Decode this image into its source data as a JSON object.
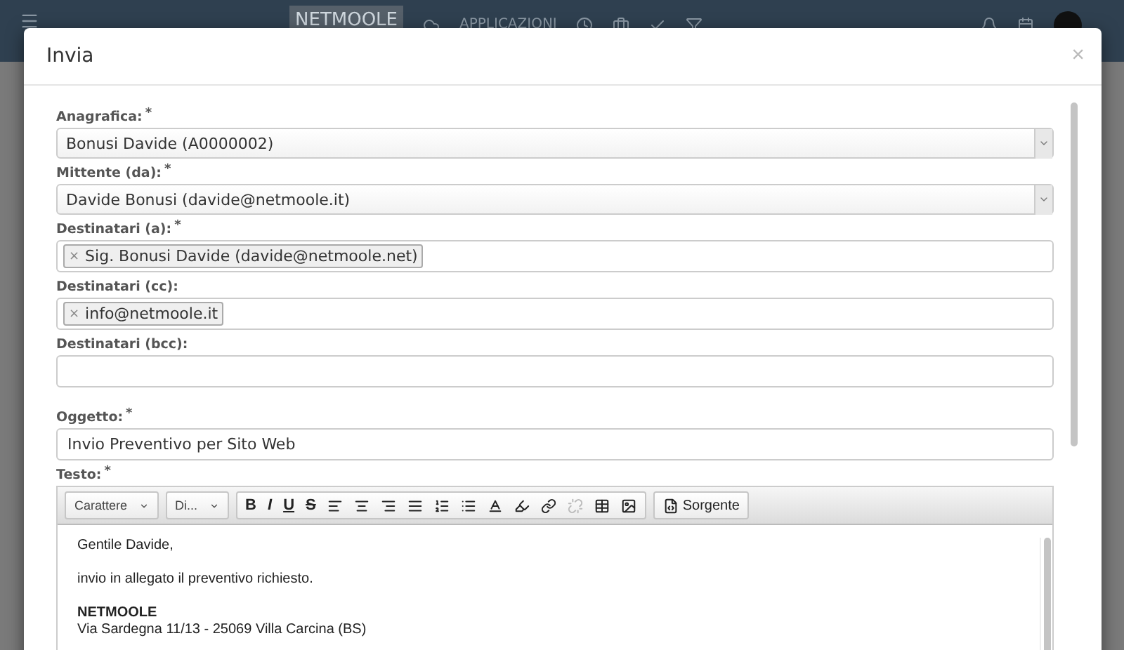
{
  "navbar": {
    "logo": "NETMOOLE",
    "apps": "APPLICAZIONI"
  },
  "dialog": {
    "title": "Invia",
    "close": "×"
  },
  "fields": [
    {
      "kind": "select",
      "label": "Anagrafica:",
      "required_mark": "*",
      "value": "Bonusi Davide (A0000002)"
    },
    {
      "kind": "select",
      "label": "Mittente (da):",
      "required_mark": "*",
      "value": "Davide Bonusi (davide@netmoole.it)"
    },
    {
      "kind": "tags",
      "label": "Destinatari (a):",
      "required_mark": "*",
      "tags": [
        {
          "remove": "×",
          "text": "Sig. Bonusi Davide (davide@netmoole.net)"
        }
      ]
    },
    {
      "kind": "tags",
      "label": "Destinatari (cc):",
      "tags": [
        {
          "remove": "×",
          "text": "info@netmoole.it"
        }
      ]
    },
    {
      "kind": "tags",
      "label": "Destinatari (bcc):"
    },
    {
      "kind": "text",
      "label": "Oggetto:",
      "required_mark": "*",
      "value": "Invio Preventivo per Sito Web"
    }
  ],
  "editor": {
    "label": "Testo:",
    "required_mark": "*",
    "groups": [
      [
        {
          "kind": "dropdown",
          "label": "Carattere"
        }
      ],
      [
        {
          "kind": "dropdown",
          "label": "Di..."
        }
      ],
      [
        {
          "kind": "bold",
          "label": "B",
          "disabled": false
        },
        {
          "kind": "italic",
          "label": "I",
          "disabled": false
        },
        {
          "kind": "underline",
          "label": "U",
          "disabled": false
        },
        {
          "kind": "strike",
          "label": "S",
          "disabled": false
        },
        {
          "kind": "align-left",
          "disabled": false
        },
        {
          "kind": "align-center",
          "disabled": false
        },
        {
          "kind": "align-right",
          "disabled": false
        },
        {
          "kind": "justify",
          "disabled": false
        },
        {
          "kind": "numbered-list",
          "disabled": false
        },
        {
          "kind": "bullet-list",
          "disabled": false
        },
        {
          "kind": "text-color",
          "disabled": false
        },
        {
          "kind": "bg-color",
          "disabled": false
        },
        {
          "kind": "link",
          "disabled": false
        },
        {
          "kind": "unlink",
          "disabled": true
        },
        {
          "kind": "table",
          "disabled": false
        },
        {
          "kind": "image",
          "disabled": false
        }
      ],
      [
        {
          "kind": "source",
          "label": "Sorgente",
          "disabled": false
        }
      ]
    ],
    "paragraphs": [
      {
        "kind": "normal",
        "text": "Gentile Davide,"
      },
      {
        "kind": "normal",
        "text": "invio in allegato il preventivo richiesto."
      },
      {
        "kind": "heading",
        "text": "NETMOOLE"
      },
      {
        "kind": "line",
        "text": "Via Sardegna 11/13 - 25069 Villa Carcina (BS)"
      }
    ]
  }
}
